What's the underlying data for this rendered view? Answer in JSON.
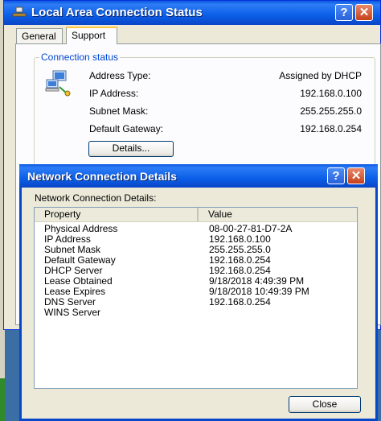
{
  "back_window": {
    "title": "Local Area Connection Status",
    "help_glyph": "?",
    "close_glyph": "✕",
    "tabs": [
      {
        "label": "General",
        "active": false
      },
      {
        "label": "Support",
        "active": true
      }
    ],
    "group_label": "Connection status",
    "rows": [
      {
        "label": "Address Type:",
        "value": "Assigned by DHCP"
      },
      {
        "label": "IP Address:",
        "value": "192.168.0.100"
      },
      {
        "label": "Subnet Mask:",
        "value": "255.255.255.0"
      },
      {
        "label": "Default Gateway:",
        "value": "192.168.0.254"
      }
    ],
    "details_button": "Details..."
  },
  "front_window": {
    "title": "Network Connection Details",
    "help_glyph": "?",
    "close_glyph": "✕",
    "sub_label": "Network Connection Details:",
    "columns": [
      "Property",
      "Value"
    ],
    "rows": [
      {
        "property": "Physical Address",
        "value": "08-00-27-81-D7-2A"
      },
      {
        "property": "IP Address",
        "value": "192.168.0.100"
      },
      {
        "property": "Subnet Mask",
        "value": "255.255.255.0"
      },
      {
        "property": "Default Gateway",
        "value": "192.168.0.254"
      },
      {
        "property": "DHCP Server",
        "value": "192.168.0.254"
      },
      {
        "property": "Lease Obtained",
        "value": "9/18/2018 4:49:39 PM"
      },
      {
        "property": "Lease Expires",
        "value": "9/18/2018 10:49:39 PM"
      },
      {
        "property": "DNS Server",
        "value": "192.168.0.254"
      },
      {
        "property": "WINS Server",
        "value": ""
      }
    ],
    "close_button": "Close"
  },
  "colors": {
    "titlebar": "#0b5fe8",
    "group_label": "#0046d5",
    "close_button_red": "#c5401b"
  }
}
